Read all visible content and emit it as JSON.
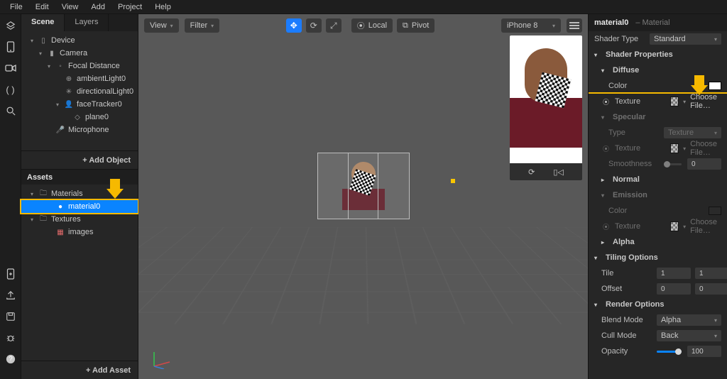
{
  "menus": [
    "File",
    "Edit",
    "View",
    "Add",
    "Project",
    "Help"
  ],
  "left": {
    "tabs": {
      "scene": "Scene",
      "layers": "Layers"
    },
    "scene_tree": {
      "device": "Device",
      "camera": "Camera",
      "focal": "Focal Distance",
      "ambient": "ambientLight0",
      "directional": "directionalLight0",
      "facetracker": "faceTracker0",
      "plane": "plane0",
      "mic": "Microphone"
    },
    "add_object": "+  Add Object",
    "assets_header": "Assets",
    "assets_tree": {
      "materials": "Materials",
      "material0": "material0",
      "textures": "Textures",
      "images": "images"
    },
    "add_asset": "+  Add Asset"
  },
  "viewport": {
    "view": "View",
    "filter": "Filter",
    "local": "Local",
    "pivot": "Pivot",
    "device": "iPhone 8"
  },
  "inspector": {
    "title_name": "material0",
    "title_type": "– Material",
    "shader_type_label": "Shader Type",
    "shader_type_value": "Standard",
    "sections": {
      "shader_props": "Shader Properties",
      "diffuse": "Diffuse",
      "specular": "Specular",
      "normal": "Normal",
      "emission": "Emission",
      "alpha": "Alpha",
      "tiling": "Tiling Options",
      "render": "Render Options"
    },
    "labels": {
      "color": "Color",
      "texture": "Texture",
      "type": "Type",
      "smoothness": "Smoothness",
      "tile": "Tile",
      "offset": "Offset",
      "blend_mode": "Blend Mode",
      "cull_mode": "Cull Mode",
      "opacity": "Opacity"
    },
    "values": {
      "choose_file": "Choose File…",
      "spec_type": "Texture",
      "smoothness": "0",
      "tile_x": "1",
      "tile_y": "1",
      "offset_x": "0",
      "offset_y": "0",
      "blend_mode": "Alpha",
      "cull_mode": "Back",
      "opacity": "100"
    }
  }
}
